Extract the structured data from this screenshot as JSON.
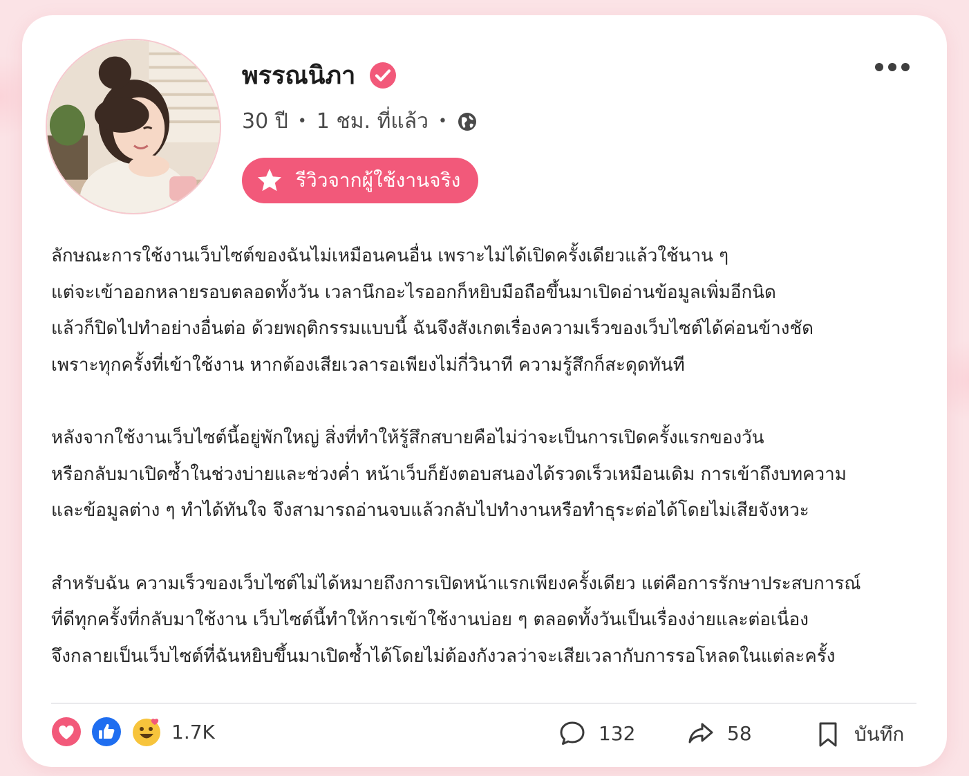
{
  "author": {
    "name": "พรรณนิภา",
    "age": "30 ปี",
    "time_ago": "1 ชม. ที่แล้ว"
  },
  "badge": {
    "label": "รีวิวจากผู้ใช้งานจริง"
  },
  "post": {
    "paragraphs": [
      [
        "ลักษณะการใช้งานเว็บไซต์ของฉันไม่เหมือนคนอื่น เพราะไม่ได้เปิดครั้งเดียวแล้วใช้นาน ๆ",
        "แต่จะเข้าออกหลายรอบตลอดทั้งวัน เวลานึกอะไรออกก็หยิบมือถือขึ้นมาเปิดอ่านข้อมูลเพิ่มอีกนิด",
        "แล้วก็ปิดไปทำอย่างอื่นต่อ ด้วยพฤติกรรมแบบนี้ ฉันจึงสังเกตเรื่องความเร็วของเว็บไซต์ได้ค่อนข้างชัด",
        "เพราะทุกครั้งที่เข้าใช้งาน หากต้องเสียเวลารอเพียงไม่กี่วินาที ความรู้สึกก็สะดุดทันที"
      ],
      [
        "หลังจากใช้งานเว็บไซต์นี้อยู่พักใหญ่ สิ่งที่ทำให้รู้สึกสบายคือไม่ว่าจะเป็นการเปิดครั้งแรกของวัน",
        "หรือกลับมาเปิดซ้ำในช่วงบ่ายและช่วงค่ำ หน้าเว็บก็ยังตอบสนองได้รวดเร็วเหมือนเดิม การเข้าถึงบทความ",
        "และข้อมูลต่าง ๆ ทำได้ทันใจ จึงสามารถอ่านจบแล้วกลับไปทำงานหรือทำธุระต่อได้โดยไม่เสียจังหวะ"
      ],
      [
        "สำหรับฉัน ความเร็วของเว็บไซต์ไม่ได้หมายถึงการเปิดหน้าแรกเพียงครั้งเดียว แต่คือการรักษาประสบการณ์",
        "ที่ดีทุกครั้งที่กลับมาใช้งาน เว็บไซต์นี้ทำให้การเข้าใช้งานบ่อย ๆ ตลอดทั้งวันเป็นเรื่องง่ายและต่อเนื่อง",
        "จึงกลายเป็นเว็บไซต์ที่ฉันหยิบขึ้นมาเปิดซ้ำได้โดยไม่ต้องกังวลว่าจะเสียเวลากับการรอโหลดในแต่ละครั้ง"
      ]
    ]
  },
  "footer": {
    "reactions_count": "1.7K",
    "comments_count": "132",
    "shares_count": "58",
    "save_label": "บันทึก"
  },
  "colors": {
    "accent": "#f2597a",
    "background": "#fbe3e6",
    "card": "#ffffff"
  },
  "icons": {
    "verified": "verified-check-icon",
    "globe": "globe-icon",
    "star": "star-icon",
    "more": "more-dots-icon",
    "love": "love-reaction-icon",
    "like": "like-reaction-icon",
    "care": "heart-eyes-reaction-icon",
    "comment": "comment-bubble-icon",
    "share": "share-arrow-icon",
    "bookmark": "bookmark-icon"
  }
}
